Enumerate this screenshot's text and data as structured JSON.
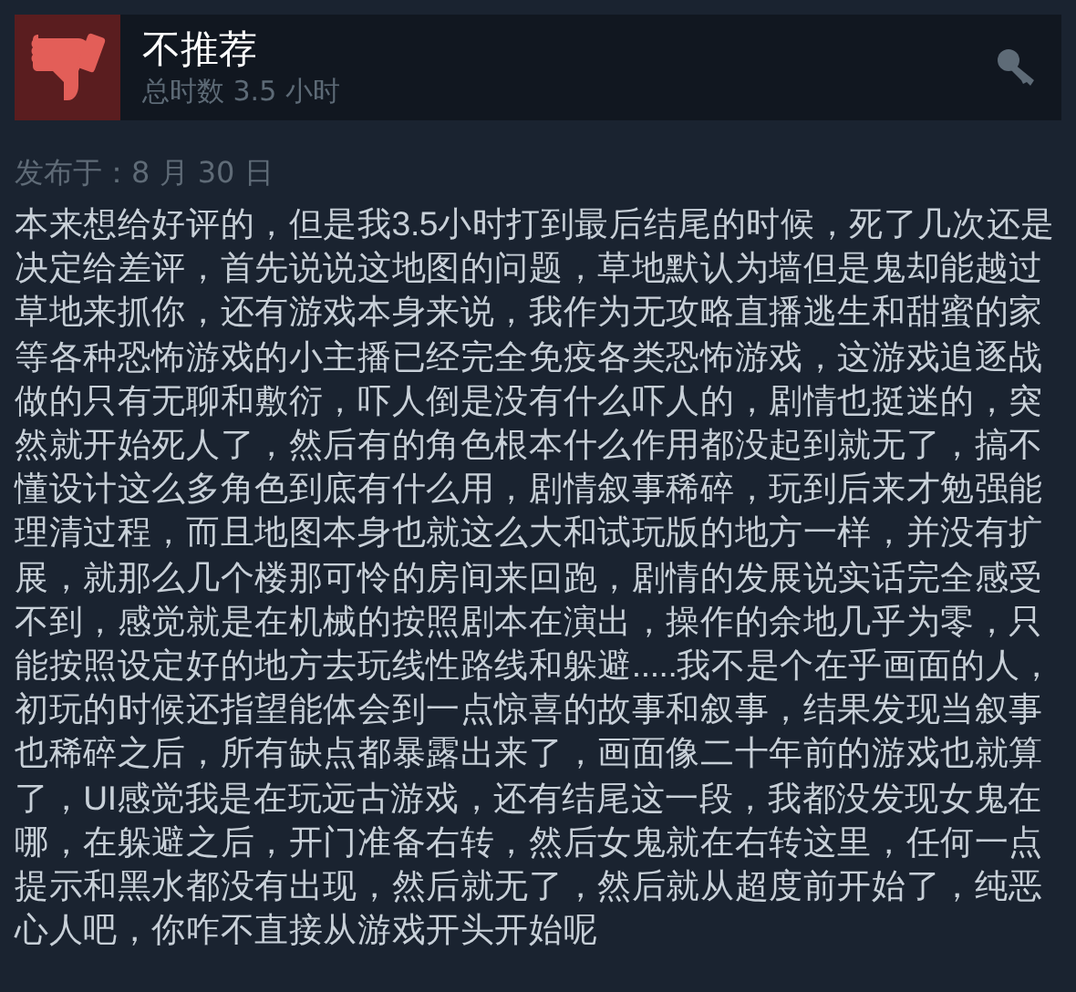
{
  "review": {
    "verdict": "不推荐",
    "recommended": false,
    "playtime": "总时数 3.5 小时",
    "posted": "发布于：8 月 30 日",
    "body": "本来想给好评的，但是我3.5小时打到最后结尾的时候，死了几次还是决定给差评，首先说说这地图的问题，草地默认为墙但是鬼却能越过草地来抓你，还有游戏本身来说，我作为无攻略直播逃生和甜蜜的家等各种恐怖游戏的小主播已经完全免疫各类恐怖游戏，这游戏追逐战做的只有无聊和敷衍，吓人倒是没有什么吓人的，剧情也挺迷的，突然就开始死人了，然后有的角色根本什么作用都没起到就无了，搞不懂设计这么多角色到底有什么用，剧情叙事稀碎，玩到后来才勉强能理清过程，而且地图本身也就这么大和试玩版的地方一样，并没有扩展，就那么几个楼那可怜的房间来回跑，剧情的发展说实话完全感受不到，感觉就是在机械的按照剧本在演出，操作的余地几乎为零，只能按照设定好的地方去玩线性路线和躲避.....我不是个在乎画面的人，初玩的时候还指望能体会到一点惊喜的故事和叙事，结果发现当叙事也稀碎之后，所有缺点都暴露出来了，画面像二十年前的游戏也就算了，UI感觉我是在玩远古游戏，还有结尾这一段，我都没发现女鬼在哪，在躲避之后，开门准备右转，然后女鬼就在右转这里，任何一点提示和黑水都没有出现，然后就无了，然后就从超度前开始了，纯恶心人吧，你咋不直接从游戏开头开始呢"
  }
}
